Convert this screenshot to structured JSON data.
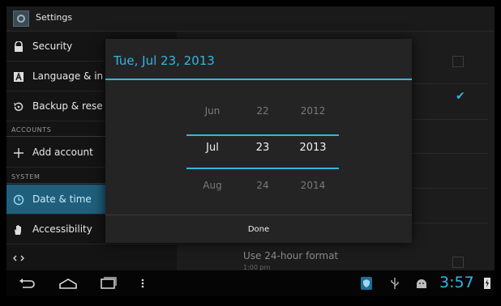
{
  "actionbar": {
    "title": "Settings"
  },
  "left": {
    "items": [
      {
        "label": "Security",
        "icon": "lock-icon"
      },
      {
        "label": "Language & in",
        "icon": "language-icon"
      },
      {
        "label": "Backup & rese",
        "icon": "backup-icon"
      }
    ],
    "section_accounts": "ACCOUNTS",
    "add_account": "Add account",
    "section_system": "SYSTEM",
    "date_time": "Date & time",
    "accessibility": "Accessibility"
  },
  "right": {
    "use24_title": "Use 24-hour format",
    "use24_sub": "1:00 pm"
  },
  "dialog": {
    "title": "Tue, Jul 23, 2013",
    "month": {
      "prev": "Jun",
      "current": "Jul",
      "next": "Aug"
    },
    "day": {
      "prev": "22",
      "current": "23",
      "next": "24"
    },
    "year": {
      "prev": "2012",
      "current": "2013",
      "next": "2014"
    },
    "done": "Done"
  },
  "statusbar": {
    "time": "3:57"
  },
  "colors": {
    "accent": "#33b5e5",
    "selected_row": "#1f5f7c"
  }
}
